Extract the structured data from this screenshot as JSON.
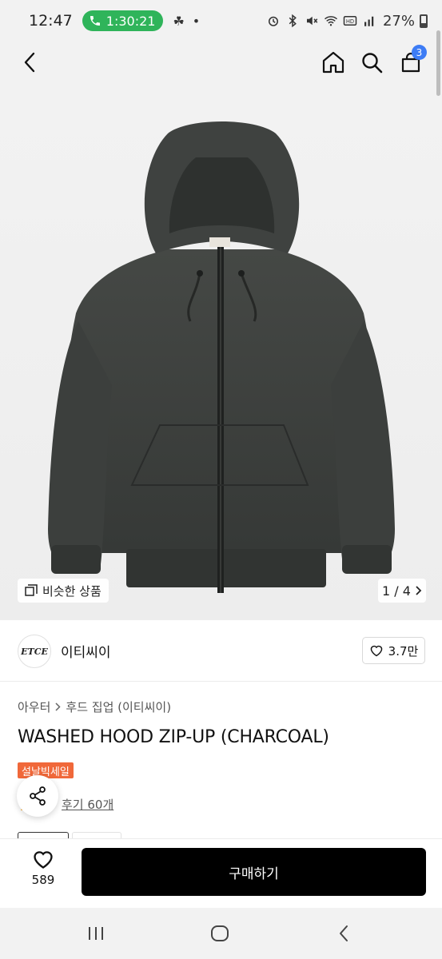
{
  "status_bar": {
    "time": "12:47",
    "call_duration": "1:30:21",
    "battery": "27%"
  },
  "header": {
    "cart_count": "3"
  },
  "gallery": {
    "similar_label": "비슷한 상품",
    "page_indicator": "1 / 4"
  },
  "brand": {
    "logo_text": "ETCE",
    "name": "이티씨이",
    "likes": "3.7만"
  },
  "product": {
    "breadcrumb": [
      "아우터",
      "후드 집업 (이티씨이)"
    ],
    "title": "WASHED HOOD ZIP-UP (CHARCOAL)",
    "sale_badge": "설날빅세일",
    "review_link": "후기 60개"
  },
  "bottom_bar": {
    "wish_count": "589",
    "buy_label": "구매하기"
  },
  "colors": {
    "accent_blue": "#3d7cf5",
    "sale_orange": "#f0683a",
    "call_green": "#2fb45a",
    "hoodie_charcoal": "#3a3d3b"
  },
  "icons": [
    "back-icon",
    "home-icon",
    "search-icon",
    "cart-icon",
    "similar-icon",
    "heart-icon",
    "share-icon",
    "recent-apps-icon",
    "home-nav-icon",
    "back-nav-icon"
  ]
}
